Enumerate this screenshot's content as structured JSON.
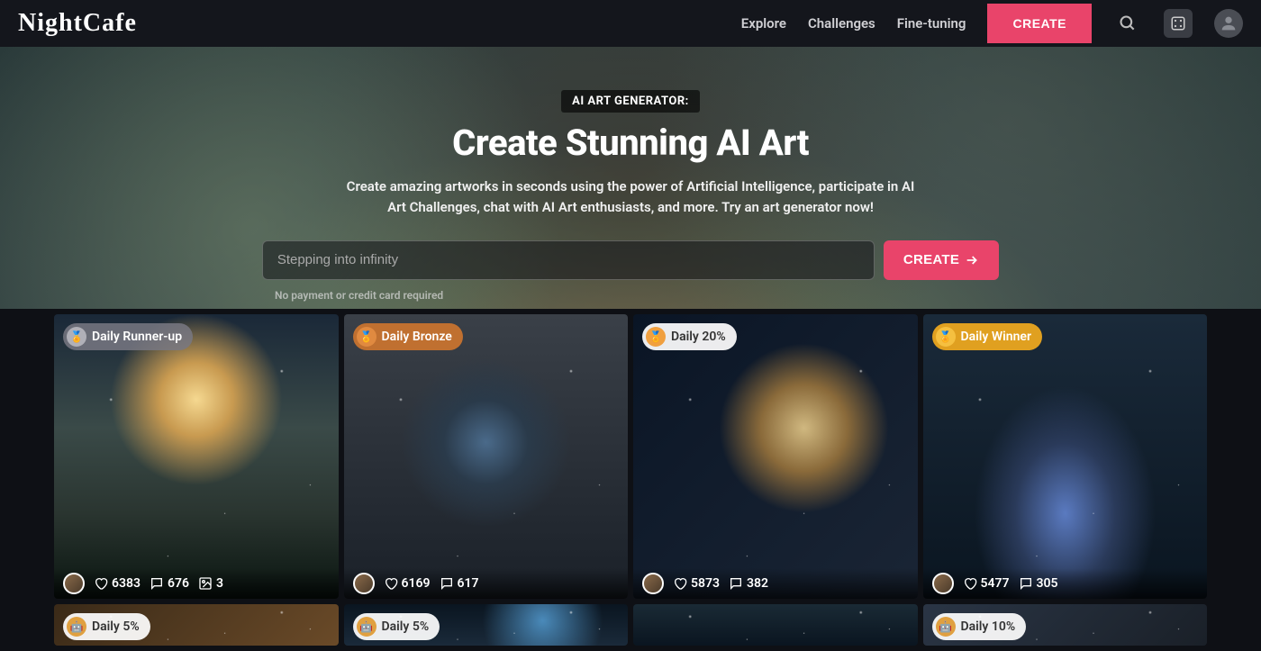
{
  "header": {
    "logo": "NightCafe",
    "nav": [
      "Explore",
      "Challenges",
      "Fine-tuning"
    ],
    "create": "CREATE"
  },
  "hero": {
    "badge": "AI ART GENERATOR:",
    "title": "Create Stunning AI Art",
    "subtitle": "Create amazing artworks in seconds using the power of Artificial Intelligence, participate in AI Art Challenges, chat with AI Art enthusiasts, and more. Try an art generator now!",
    "placeholder": "Stepping into infinity",
    "create": "CREATE",
    "note": "No payment or credit card required"
  },
  "cards": [
    {
      "badge": "Daily Runner-up",
      "badgeBg": "rgba(120,120,130,.85)",
      "medalBg": "#b0b0b8",
      "likes": "6383",
      "comments": "676",
      "extra": "3"
    },
    {
      "badge": "Daily Bronze",
      "badgeBg": "#c07030",
      "medalBg": "#e08a40",
      "likes": "6169",
      "comments": "617"
    },
    {
      "badge": "Daily 20%",
      "badgeBg": "rgba(255,255,255,.92)",
      "badgeColor": "#333",
      "medalBg": "#f0a040",
      "likes": "5873",
      "comments": "382"
    },
    {
      "badge": "Daily Winner",
      "badgeBg": "#e0a020",
      "medalBg": "#f5c040",
      "likes": "5477",
      "comments": "305"
    }
  ],
  "cards2": [
    {
      "badge": "Daily 5%",
      "badgeBg": "rgba(255,255,255,.92)",
      "badgeColor": "#333"
    },
    {
      "badge": "Daily 5%",
      "badgeBg": "rgba(255,255,255,.92)",
      "badgeColor": "#333"
    },
    {
      "badge": "",
      "badgeBg": "transparent"
    },
    {
      "badge": "Daily 10%",
      "badgeBg": "rgba(255,255,255,.92)",
      "badgeColor": "#333"
    }
  ]
}
